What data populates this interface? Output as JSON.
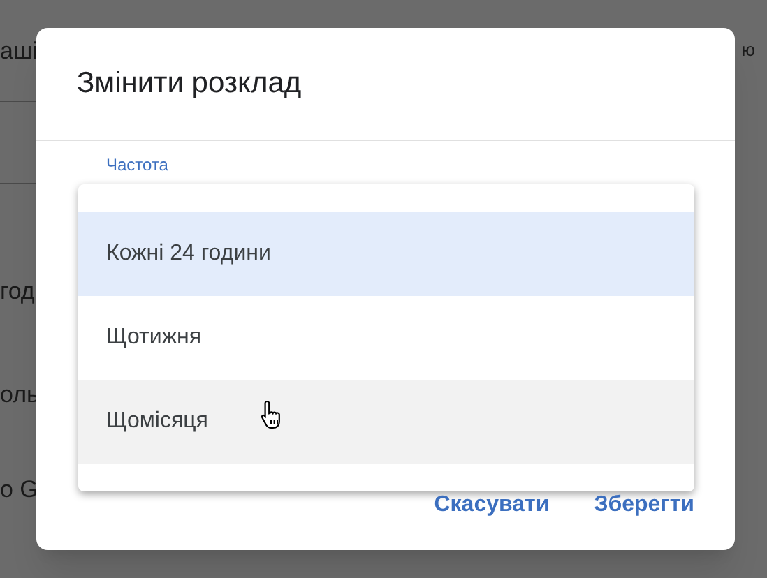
{
  "background": {
    "fragments": [
      "аші",
      "ю",
      "год",
      "оль",
      "о G"
    ]
  },
  "dialog": {
    "title": "Змінити розклад",
    "field": {
      "label": "Частота"
    },
    "menu": {
      "items": [
        {
          "label": "Кожні 24 години",
          "selected": true,
          "hovered": false
        },
        {
          "label": "Щотижня",
          "selected": false,
          "hovered": false
        },
        {
          "label": "Щомісяця",
          "selected": false,
          "hovered": true
        }
      ]
    },
    "buttons": [
      "Скасувати",
      "Зберегти"
    ]
  }
}
